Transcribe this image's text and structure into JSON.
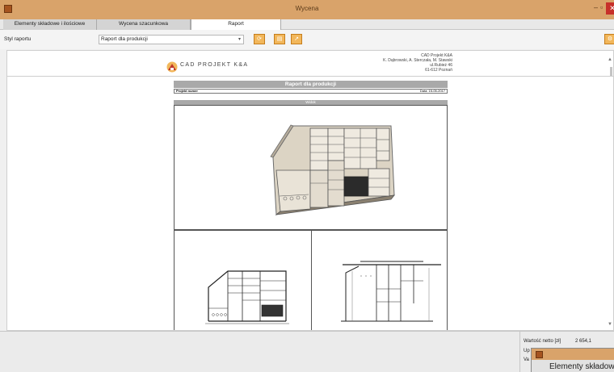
{
  "window": {
    "title": "Wycena",
    "minimize_glyph": "–",
    "maximize_glyph": "▫",
    "close_glyph": "✕",
    "title_bar_color": "#d9a36a",
    "close_color": "#c7302a"
  },
  "tabs": [
    {
      "label": "Elementy składowe i ilościowe",
      "active": false
    },
    {
      "label": "Wycena szacunkowa",
      "active": false
    },
    {
      "label": "Raport",
      "active": true
    }
  ],
  "toolbar": {
    "style_label": "Styl raportu",
    "style_value": "Raport dla produkcji",
    "dropdown_glyph": "▾",
    "button_icons": [
      "refresh-icon",
      "print-icon",
      "export-icon",
      "settings-icon"
    ]
  },
  "report": {
    "company_logo_text": "CAD PROJEKT K&A",
    "address_lines": [
      "CAD Projekt K&A",
      "K. Dąbrowski, A. Sterczała, M. Stawski",
      "ul.Rubież 46",
      "61-612 Poznań"
    ],
    "title": "Raport dla produkcji",
    "project_label": "Projekt numer",
    "date_label": "Data:",
    "date_value": "15-05-2017",
    "section_label": "Widok"
  },
  "summary": {
    "net_value_label": "Wartość netto [zł]",
    "net_value": "2 654,1",
    "row2_label": "Up",
    "row3_label": "Va"
  },
  "popup": {
    "tab_label": "Elementy składowe"
  },
  "colors": {
    "accent_orange": "#f2b75b",
    "report_header_gray": "#a9a9a9"
  }
}
